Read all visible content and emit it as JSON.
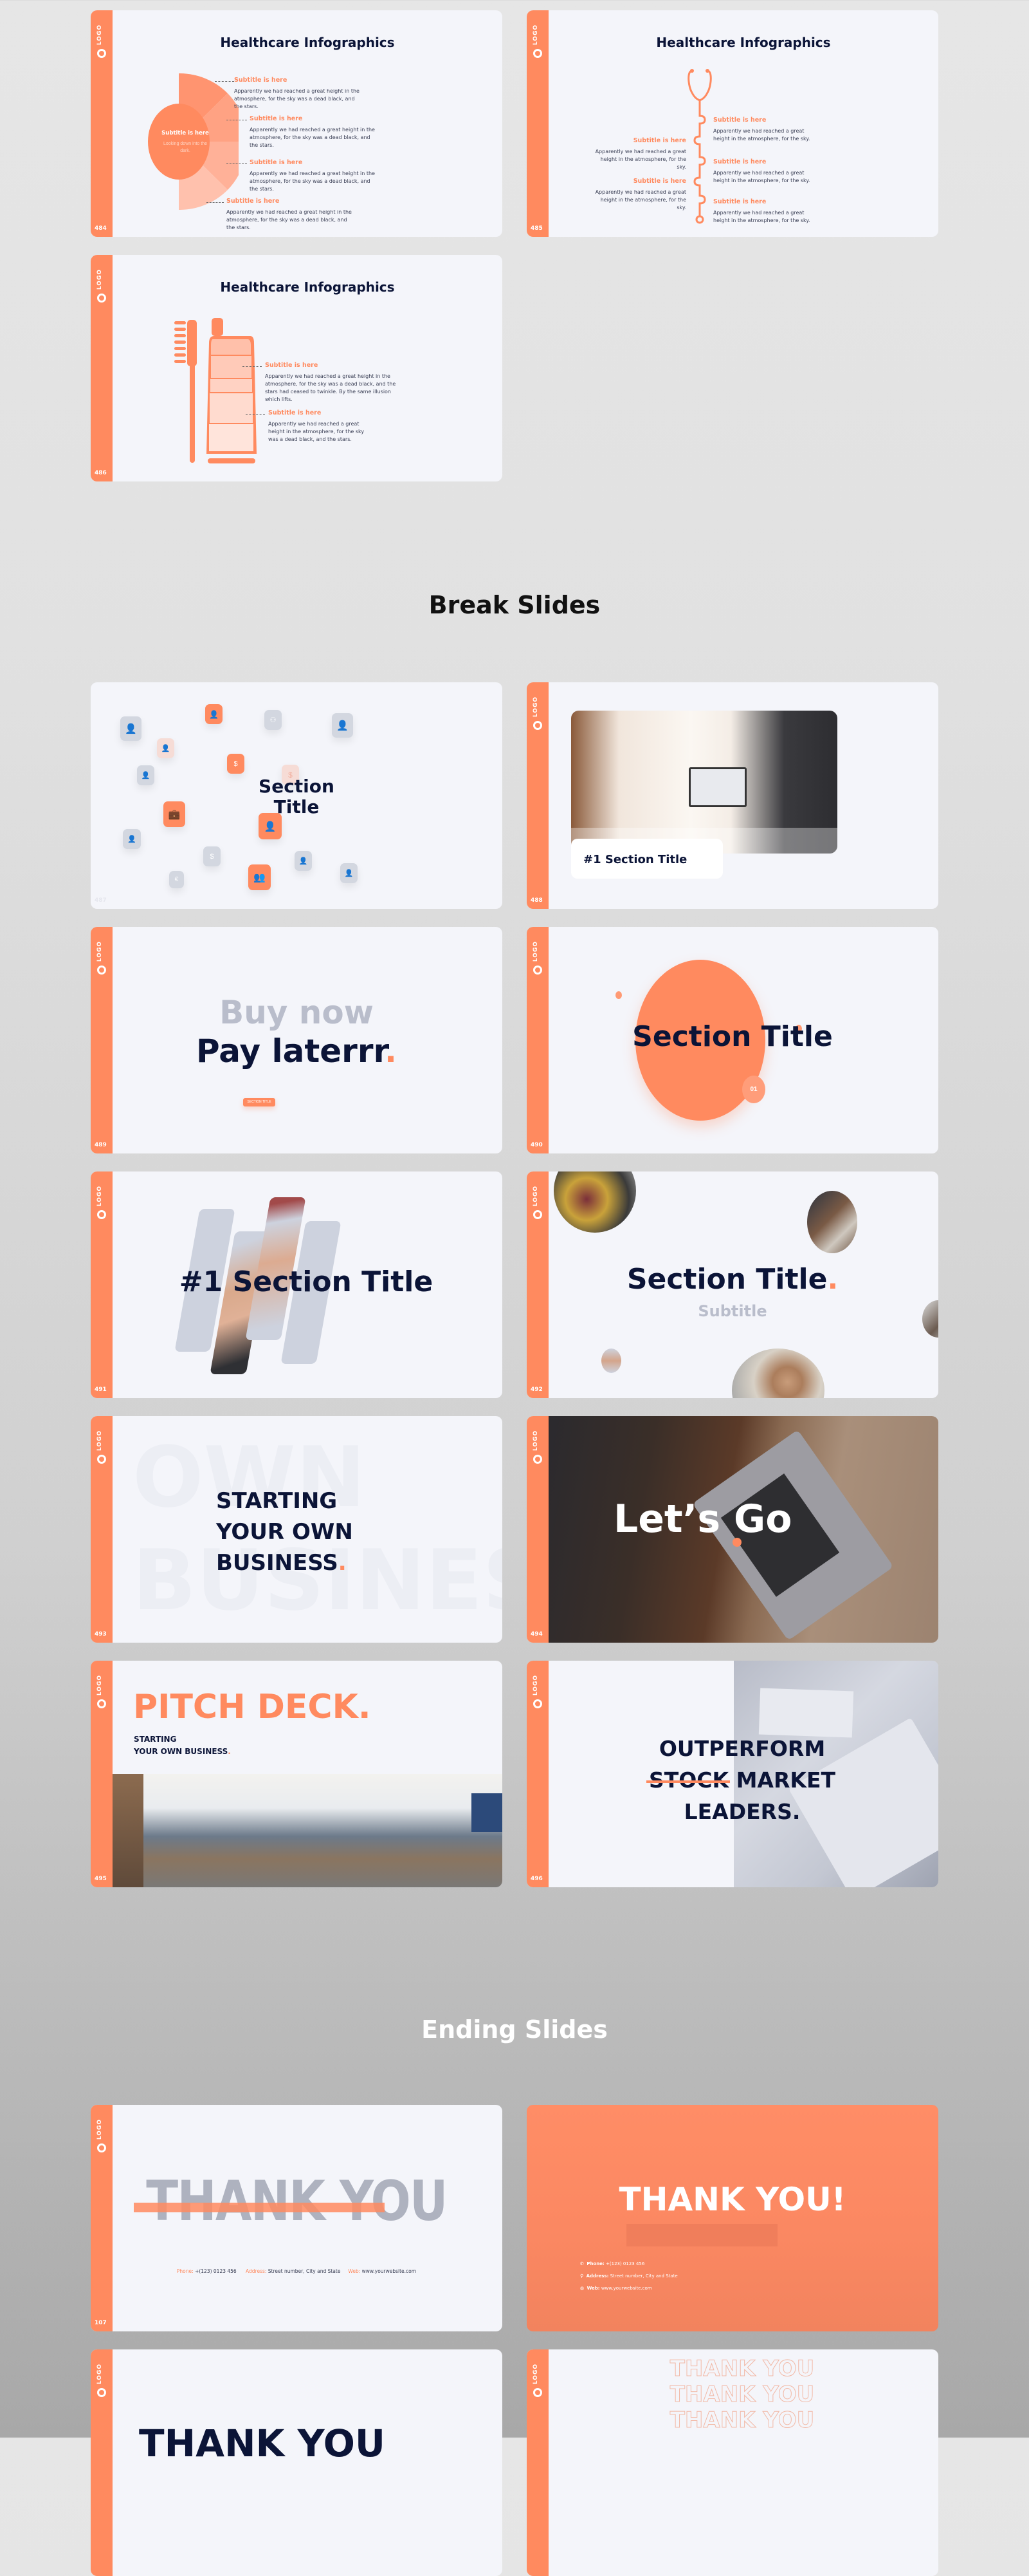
{
  "colors": {
    "accent": "#ff8a5f",
    "navy": "#0b1437",
    "slide_bg": "#f4f5fa",
    "muted_gray": "#b9bdcb"
  },
  "common": {
    "logo_label": "LOGO",
    "logo_icon": "ring-icon"
  },
  "sections": {
    "break": "Break Slides",
    "ending": "Ending Slides"
  },
  "slides": {
    "s484": {
      "page": "484",
      "title": "Healthcare Infographics",
      "center_title": "Subtitle is here",
      "center_text": "Looking down into the dark.",
      "items": [
        {
          "subtitle": "Subtitle is here",
          "text": "Apparently we had reached a great height in the atmosphere, for the sky was a dead black, and the stars."
        },
        {
          "subtitle": "Subtitle is here",
          "text": "Apparently we had reached a great height in the atmosphere, for the sky was a dead black, and the stars."
        },
        {
          "subtitle": "Subtitle is here",
          "text": "Apparently we had reached a great height in the atmosphere, for the sky was a dead black, and the stars."
        },
        {
          "subtitle": "Subtitle is here",
          "text": "Apparently we had reached a great height in the atmosphere, for the sky was a dead black, and the stars."
        }
      ]
    },
    "s485": {
      "page": "485",
      "title": "Healthcare Infographics",
      "icon": "stethoscope-icon",
      "items": [
        {
          "subtitle": "Subtitle is here",
          "text": "Apparently we had reached a great height in the atmosphere, for the sky."
        },
        {
          "subtitle": "Subtitle is here",
          "text": "Apparently we had reached a great height in the atmosphere, for the sky."
        },
        {
          "subtitle": "Subtitle is here",
          "text": "Apparently we had reached a great height in the atmosphere, for the sky."
        },
        {
          "subtitle": "Subtitle is here",
          "text": "Apparently we had reached a great height in the atmosphere, for the sky."
        },
        {
          "subtitle": "Subtitle is here",
          "text": "Apparently we had reached a great height in the atmosphere, for the sky."
        }
      ]
    },
    "s486": {
      "page": "486",
      "title": "Healthcare Infographics",
      "icon": "toothpaste-toothbrush-icon",
      "items": [
        {
          "subtitle": "Subtitle is here",
          "text": "Apparently we had reached a great height in the atmosphere, for the sky was a dead black, and the stars had ceased to twinkle. By the same illusion which lifts."
        },
        {
          "subtitle": "Subtitle is here",
          "text": "Apparently we had reached a great height in the atmosphere, for the sky was a dead black, and the stars."
        }
      ]
    },
    "s487": {
      "page": "487",
      "title_line1": "Section",
      "title_line2": "Title"
    },
    "s488": {
      "page": "488",
      "title": "#1 Section Title",
      "photo": "two-women-laptop-photo"
    },
    "s489": {
      "page": "489",
      "line1": "Buy now",
      "line2": "Pay laterrr",
      "dot": ".",
      "button": "SECTION TITLE"
    },
    "s490": {
      "page": "490",
      "title": "Section Title",
      "badge": "01"
    },
    "s491": {
      "page": "491",
      "title": "#1 Section Title",
      "photo": "handshake-photo"
    },
    "s492": {
      "page": "492",
      "title": "Section Title",
      "dot": ".",
      "subtitle": "Subtitle"
    },
    "s493": {
      "page": "493",
      "bg_word1": "OWN",
      "bg_word2": "BUSINESS",
      "line1": "STARTING",
      "line2": "YOUR OWN",
      "line3": "BUSINESS",
      "dot": "."
    },
    "s494": {
      "page": "494",
      "title": "Let’s Go",
      "photo": "laptop-desk-photo"
    },
    "s495": {
      "page": "495",
      "title": "PITCH DECK.",
      "line1": "STARTING",
      "line2": "YOUR OWN BUSINESS",
      "dot": ".",
      "photo": "office-photo"
    },
    "s496": {
      "page": "496",
      "line1": "OUTPERFORM",
      "strike": "STOCK",
      "line2_rest": "MARKET",
      "line3": "LEADERS.",
      "photo": "typing-laptop-photo"
    },
    "s107": {
      "page": "107",
      "title": "THANK YOU",
      "phone_label": "Phone:",
      "phone": "+(123) 0123 456",
      "address_label": "Address:",
      "address": "Street number, City and State",
      "web_label": "Web:",
      "web": "www.yourwebsite.com"
    },
    "thanks_orange": {
      "title": "THANK YOU!",
      "phone_label": "Phone:",
      "phone": "+(123) 0123 456",
      "address_label": "Address:",
      "address": "Street number, City and State",
      "web_label": "Web:",
      "web": "www.yourwebsite.com"
    },
    "thanks_partial_left": {
      "title": "THANK YOU"
    },
    "thanks_outline": {
      "lines": [
        "THANK YOU",
        "THANK YOU",
        "THANK YOU"
      ]
    }
  }
}
